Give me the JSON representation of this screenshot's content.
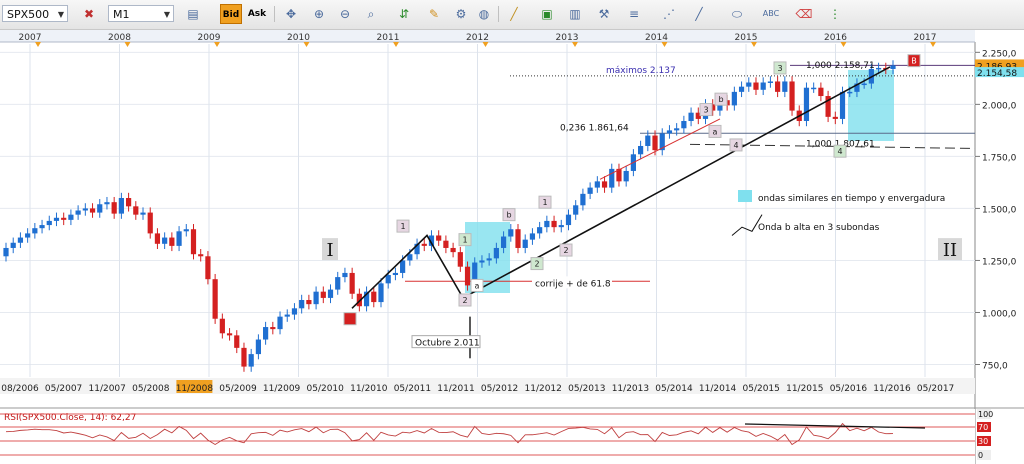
{
  "toolbar": {
    "symbol": "SPX500",
    "timeframe": "M1",
    "bid_label": "Bid",
    "ask_label": "Ask",
    "icons": [
      "chart-type-icon",
      "crosshair-icon",
      "zoom-in-icon",
      "zoom-out-icon",
      "indicators-icon",
      "trend-line-icon",
      "drawing-tools-icon",
      "horizontal-line-icon",
      "fibonacci-icon",
      "text-icon",
      "eraser-icon",
      "settings-icon"
    ]
  },
  "chart_data": {
    "type": "candlestick",
    "symbol": "SPX500",
    "timeframe": "M1",
    "top_axis_years": [
      "2007",
      "2008",
      "2009",
      "2010",
      "2011",
      "2012",
      "2013",
      "2014",
      "2015",
      "2016",
      "2017"
    ],
    "x_tick_labels": [
      "08/2006",
      "05/2007",
      "11/2007",
      "05/2008",
      "11/2008",
      "05/2009",
      "11/2009",
      "05/2010",
      "11/2010",
      "05/2011",
      "11/2011",
      "05/2012",
      "11/2012",
      "05/2013",
      "11/2013",
      "05/2014",
      "11/2014",
      "05/2015",
      "11/2015",
      "05/2016",
      "11/2016",
      "05/2017"
    ],
    "highlighted_x_label": "11/2008",
    "y_tick_labels": [
      "750,0",
      "1.000,0",
      "1.250,0",
      "1.500,0",
      "1.750,0",
      "2.000,0",
      "2.250,0"
    ],
    "ylim": [
      690,
      2290
    ],
    "price_labels": {
      "current": "2.186,93",
      "second": "2.154,58"
    },
    "colors": {
      "up": "#1f6fd1",
      "down": "#d42020",
      "accent": "#f0a020",
      "highlight_box": "#7fe0ee"
    },
    "candles": [
      [
        1270,
        1310
      ],
      [
        1310,
        1335
      ],
      [
        1335,
        1360
      ],
      [
        1360,
        1380
      ],
      [
        1380,
        1405
      ],
      [
        1405,
        1420
      ],
      [
        1420,
        1440
      ],
      [
        1440,
        1455
      ],
      [
        1455,
        1445
      ],
      [
        1445,
        1470
      ],
      [
        1470,
        1490
      ],
      [
        1490,
        1500
      ],
      [
        1500,
        1480
      ],
      [
        1480,
        1520
      ],
      [
        1520,
        1530
      ],
      [
        1530,
        1475
      ],
      [
        1475,
        1550
      ],
      [
        1550,
        1510
      ],
      [
        1510,
        1470
      ],
      [
        1470,
        1480
      ],
      [
        1480,
        1380
      ],
      [
        1380,
        1330
      ],
      [
        1330,
        1360
      ],
      [
        1360,
        1320
      ],
      [
        1320,
        1390
      ],
      [
        1390,
        1400
      ],
      [
        1400,
        1280
      ],
      [
        1280,
        1270
      ],
      [
        1270,
        1160
      ],
      [
        1160,
        970
      ],
      [
        970,
        900
      ],
      [
        900,
        890
      ],
      [
        890,
        830
      ],
      [
        830,
        740
      ],
      [
        740,
        800
      ],
      [
        800,
        870
      ],
      [
        870,
        930
      ],
      [
        930,
        920
      ],
      [
        920,
        980
      ],
      [
        980,
        990
      ],
      [
        990,
        1020
      ],
      [
        1020,
        1060
      ],
      [
        1060,
        1040
      ],
      [
        1040,
        1100
      ],
      [
        1100,
        1070
      ],
      [
        1070,
        1110
      ],
      [
        1110,
        1170
      ],
      [
        1170,
        1190
      ],
      [
        1190,
        1090
      ],
      [
        1090,
        1030
      ],
      [
        1030,
        1100
      ],
      [
        1100,
        1050
      ],
      [
        1050,
        1140
      ],
      [
        1140,
        1180
      ],
      [
        1180,
        1190
      ],
      [
        1190,
        1250
      ],
      [
        1250,
        1280
      ],
      [
        1280,
        1330
      ],
      [
        1330,
        1320
      ],
      [
        1320,
        1370
      ],
      [
        1370,
        1345
      ],
      [
        1345,
        1310
      ],
      [
        1310,
        1290
      ],
      [
        1290,
        1220
      ],
      [
        1220,
        1130
      ],
      [
        1130,
        1240
      ],
      [
        1240,
        1250
      ],
      [
        1250,
        1260
      ],
      [
        1260,
        1310
      ],
      [
        1310,
        1365
      ],
      [
        1365,
        1400
      ],
      [
        1400,
        1310
      ],
      [
        1310,
        1350
      ],
      [
        1350,
        1380
      ],
      [
        1380,
        1410
      ],
      [
        1410,
        1440
      ],
      [
        1440,
        1410
      ],
      [
        1410,
        1420
      ],
      [
        1420,
        1470
      ],
      [
        1470,
        1515
      ],
      [
        1515,
        1570
      ],
      [
        1570,
        1600
      ],
      [
        1600,
        1630
      ],
      [
        1630,
        1600
      ],
      [
        1600,
        1690
      ],
      [
        1690,
        1630
      ],
      [
        1630,
        1680
      ],
      [
        1680,
        1760
      ],
      [
        1760,
        1800
      ],
      [
        1800,
        1850
      ],
      [
        1850,
        1780
      ],
      [
        1780,
        1860
      ],
      [
        1860,
        1875
      ],
      [
        1875,
        1885
      ],
      [
        1885,
        1920
      ],
      [
        1920,
        1960
      ],
      [
        1960,
        1930
      ],
      [
        1930,
        2000
      ],
      [
        2000,
        1970
      ],
      [
        1970,
        2020
      ],
      [
        2020,
        1995
      ],
      [
        1995,
        2060
      ],
      [
        2060,
        2085
      ],
      [
        2085,
        2105
      ],
      [
        2105,
        2070
      ],
      [
        2070,
        2105
      ],
      [
        2105,
        2110
      ],
      [
        2110,
        2060
      ],
      [
        2060,
        2110
      ],
      [
        2110,
        1970
      ],
      [
        1970,
        1920
      ],
      [
        1920,
        2080
      ],
      [
        2080,
        2080
      ],
      [
        2080,
        2040
      ],
      [
        2040,
        1940
      ],
      [
        1940,
        1930
      ],
      [
        1930,
        2060
      ],
      [
        2060,
        2060
      ],
      [
        2060,
        2100
      ],
      [
        2100,
        2100
      ],
      [
        2100,
        2170
      ],
      [
        2170,
        2175
      ],
      [
        2175,
        2170
      ],
      [
        2170,
        2187
      ]
    ],
    "annotations": {
      "maximos": "máximos 2.137",
      "fib_1000_top": "1,000 2.158,71",
      "fib_0236": "0,236 1.861,64",
      "fib_1000_bottom": "1,000 1.807,61",
      "octubre": "Octubre 2.011",
      "corrije": "corrije + de 61.8",
      "onda_ii_large": "II",
      "onda_i_large": "I",
      "legend_similar": "ondas similares en tiempo y envergadura",
      "legend_onda_b": "Onda b alta en 3 subondas",
      "wave_labels": [
        {
          "t": "1",
          "kind": "pink"
        },
        {
          "t": "1",
          "kind": "green"
        },
        {
          "t": "2",
          "kind": "pink"
        },
        {
          "t": "a",
          "kind": "white"
        },
        {
          "t": "b",
          "kind": "pink"
        },
        {
          "t": "1",
          "kind": "pink"
        },
        {
          "t": "2",
          "kind": "pink"
        },
        {
          "t": "2",
          "kind": "green"
        },
        {
          "t": "3",
          "kind": "pink"
        },
        {
          "t": "b",
          "kind": "pink"
        },
        {
          "t": "a",
          "kind": "pink"
        },
        {
          "t": "4",
          "kind": "pink"
        },
        {
          "t": "3",
          "kind": "green"
        },
        {
          "t": "4",
          "kind": "green"
        },
        {
          "t": "B",
          "kind": "red"
        },
        {
          "t": "",
          "kind": "red"
        }
      ]
    }
  },
  "rsi": {
    "label": "RSI(SPX500.Close, 14): 62,27",
    "levels": [
      "100",
      "70",
      "30",
      "0"
    ]
  }
}
